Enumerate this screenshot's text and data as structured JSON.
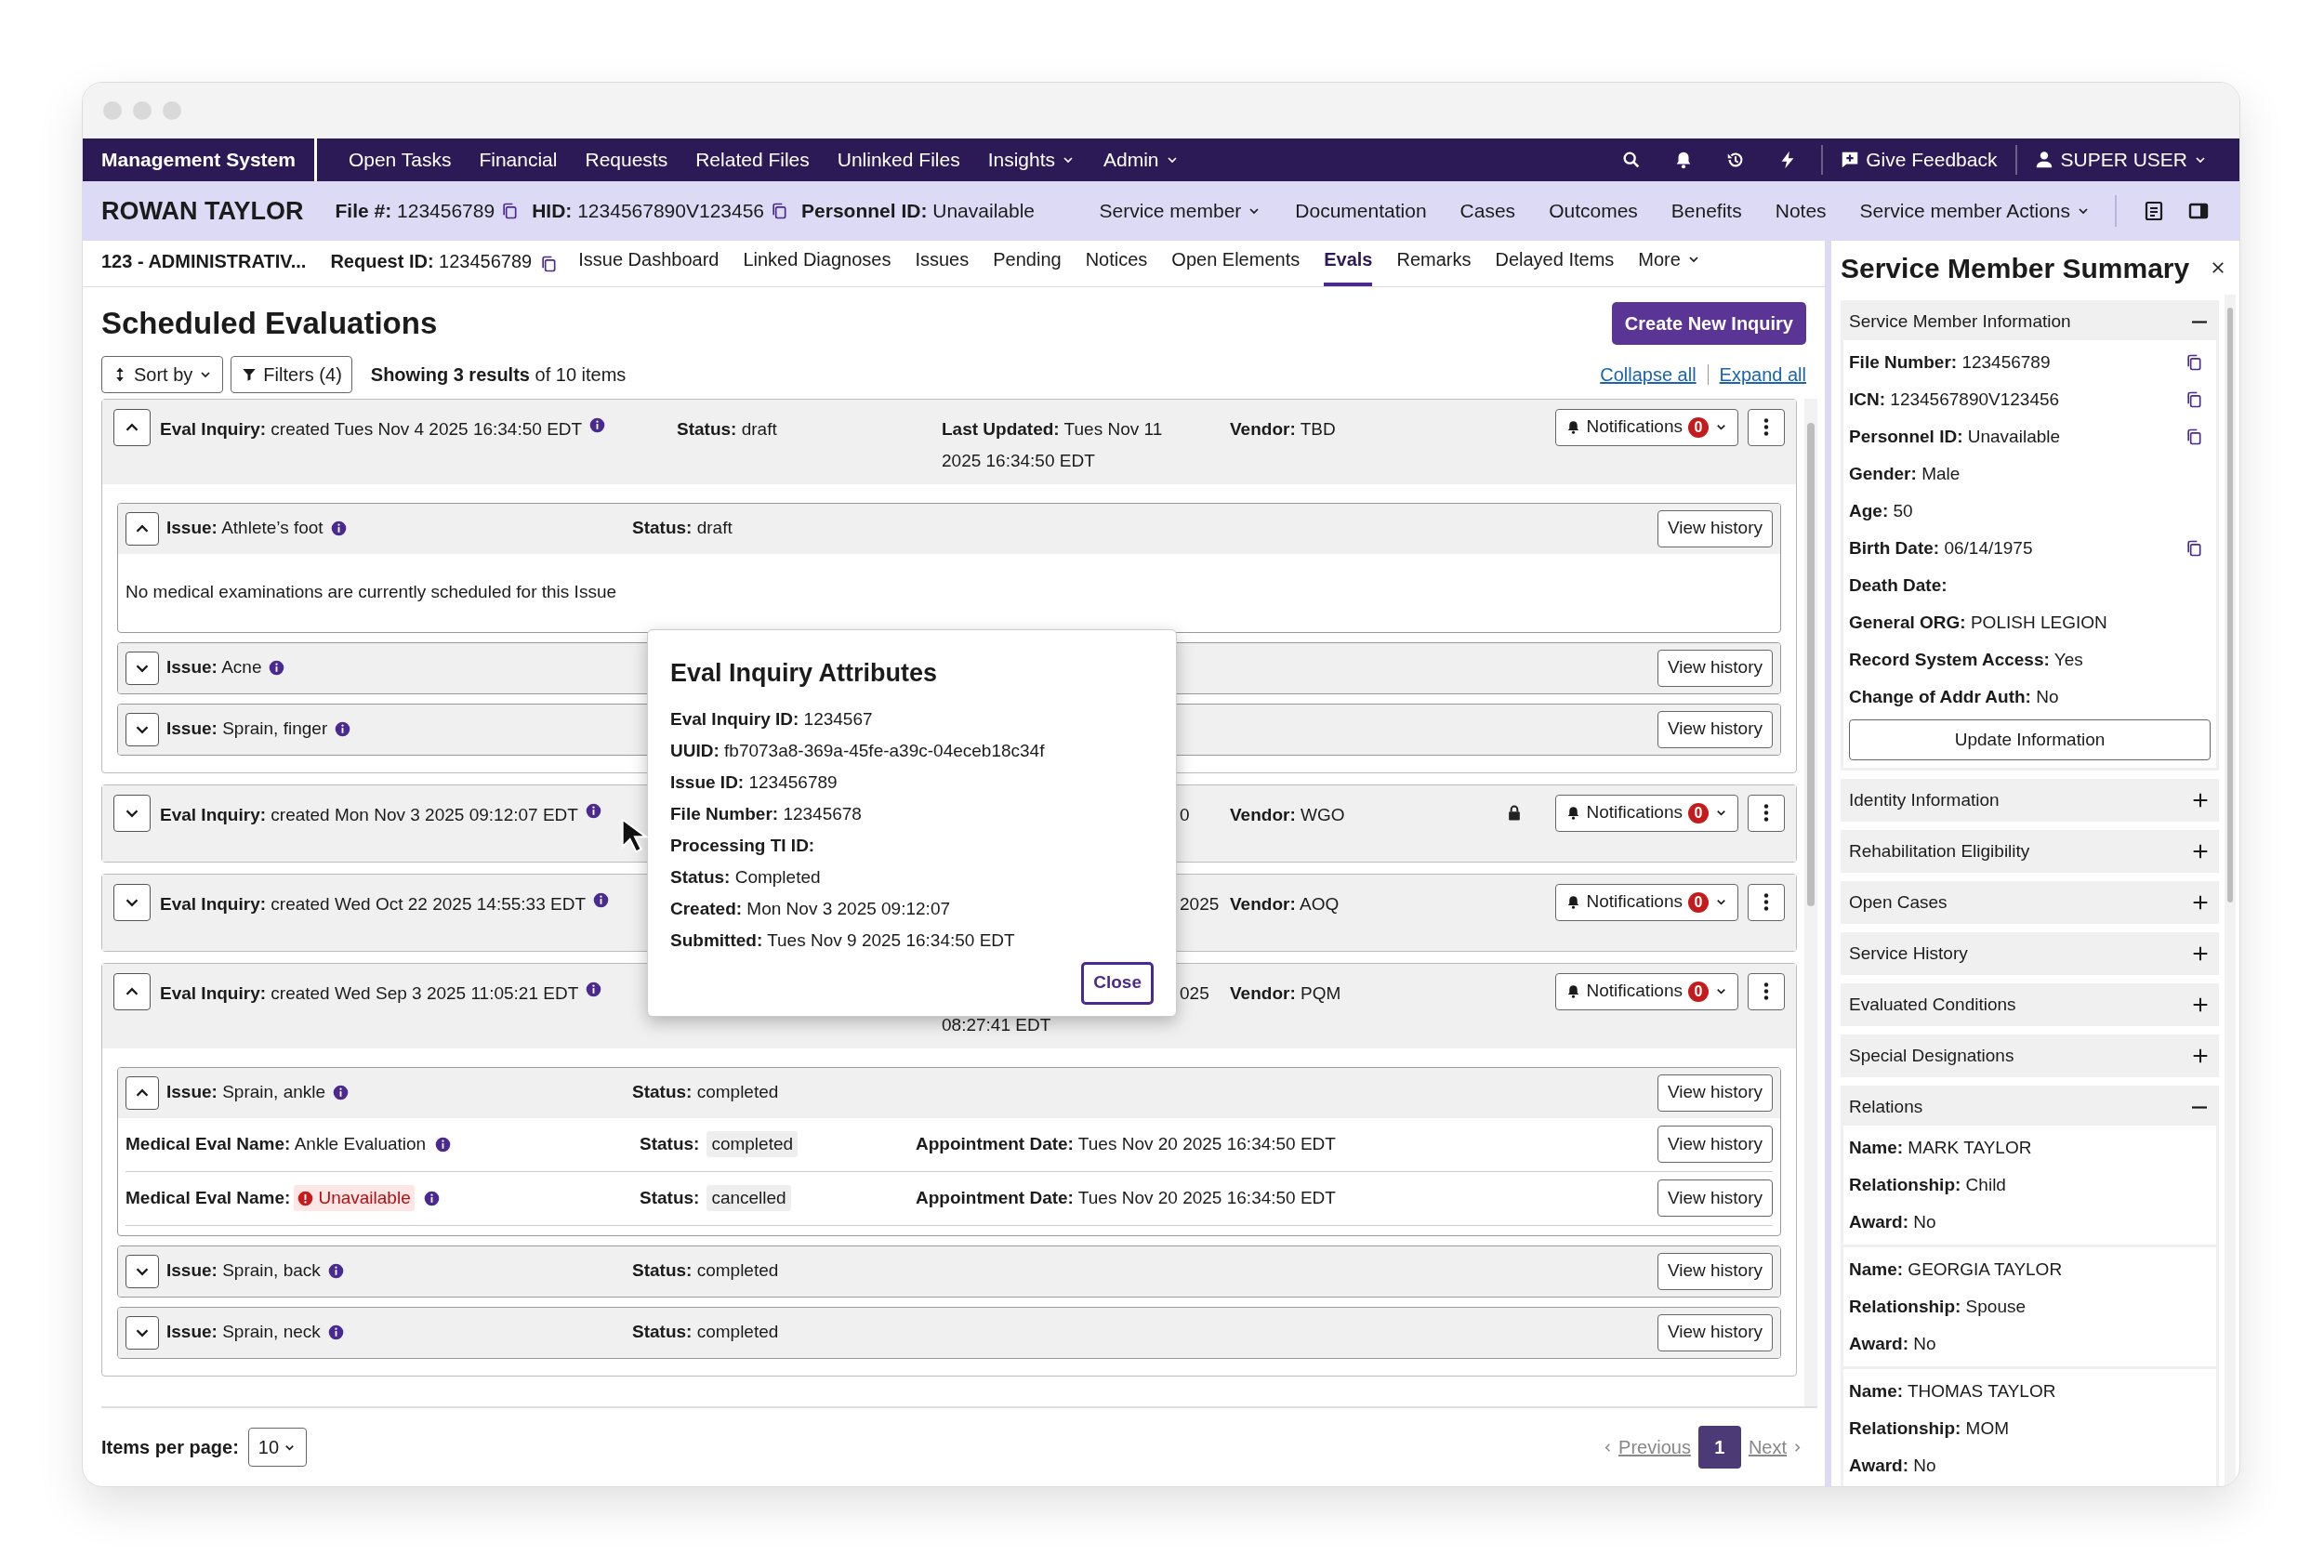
{
  "app_name": "Management System",
  "nav_items": [
    {
      "label": "Open Tasks",
      "dropdown": false
    },
    {
      "label": "Financial",
      "dropdown": false
    },
    {
      "label": "Requests",
      "dropdown": false
    },
    {
      "label": "Related Files",
      "dropdown": false
    },
    {
      "label": "Unlinked Files",
      "dropdown": false
    },
    {
      "label": "Insights",
      "dropdown": true
    },
    {
      "label": "Admin",
      "dropdown": true
    }
  ],
  "feedback": "Give Feedback",
  "user": "SUPER USER",
  "member": {
    "name": "ROWAN TAYLOR",
    "fields": [
      {
        "label": "File #:",
        "value": "123456789",
        "copy": true
      },
      {
        "label": "HID:",
        "value": "1234567890V123456",
        "copy": true
      },
      {
        "label": "Personnel ID:",
        "value": "Unavailable",
        "copy": false
      }
    ]
  },
  "member_nav": [
    {
      "label": "Service member",
      "dropdown": true
    },
    {
      "label": "Documentation",
      "dropdown": false
    },
    {
      "label": "Cases",
      "dropdown": false
    },
    {
      "label": "Outcomes",
      "dropdown": false
    },
    {
      "label": "Benefits",
      "dropdown": false
    },
    {
      "label": "Notes",
      "dropdown": false
    },
    {
      "label": "Service member Actions",
      "dropdown": true
    }
  ],
  "request": {
    "name": "123 - ADMINISTRATIV...",
    "label": "Request ID:",
    "value": "123456789"
  },
  "tabs": [
    {
      "label": "Issue Dashboard",
      "selected": false,
      "dropdown": false
    },
    {
      "label": "Linked Diagnoses",
      "selected": false,
      "dropdown": false
    },
    {
      "label": "Issues",
      "selected": false,
      "dropdown": false
    },
    {
      "label": "Pending",
      "selected": false,
      "dropdown": false
    },
    {
      "label": "Notices",
      "selected": false,
      "dropdown": false
    },
    {
      "label": "Open Elements",
      "selected": false,
      "dropdown": false
    },
    {
      "label": "Evals",
      "selected": true,
      "dropdown": false
    },
    {
      "label": "Remarks",
      "selected": false,
      "dropdown": false
    },
    {
      "label": "Delayed Items",
      "selected": false,
      "dropdown": false
    },
    {
      "label": "More",
      "selected": false,
      "dropdown": true
    }
  ],
  "page_title": "Scheduled Evaluations",
  "create_button": "Create New Inquiry",
  "sort": "Sort by",
  "filters": "Filters (4)",
  "results": "**Showing 3 results** of 10 items",
  "collapse_all": "Collapse all",
  "expand_all": "Expand all",
  "inquiries": [
    {
      "expanded": true,
      "covered": false,
      "label": "Eval Inquiry:",
      "created": "created Tues Nov 4 2025 16:34:50 EDT",
      "status_label": "Status:",
      "status": "draft",
      "updated_label": "Last Updated:",
      "updated_lines": [
        "Tues Nov 11",
        "2025 16:34:50 EDT"
      ],
      "vendor_label": "Vendor:",
      "vendor": "TBD",
      "locked": false,
      "notifications": "Notifications",
      "count": "0",
      "issues": [
        {
          "expanded": true,
          "label": "Issue:",
          "name": "Athlete’s foot",
          "status_label": "Status:",
          "status": "draft",
          "history": "View history",
          "message": "No medical examinations are currently scheduled for this Issue"
        },
        {
          "expanded": false,
          "label": "Issue:",
          "name": "Acne",
          "history": "View history"
        },
        {
          "expanded": false,
          "label": "Issue:",
          "name": "Sprain, finger",
          "history": "View history"
        }
      ]
    },
    {
      "expanded": false,
      "covered": true,
      "label": "Eval Inquiry:",
      "created": "created Mon Nov 3 2025 09:12:07 EDT",
      "updated_lines": [
        "0"
      ],
      "vendor_label": "Vendor:",
      "vendor": "WGO",
      "locked": true,
      "notifications": "Notifications",
      "count": "0"
    },
    {
      "expanded": false,
      "covered": true,
      "label": "Eval Inquiry:",
      "created": "created Wed Oct 22 2025 14:55:33 EDT",
      "updated_lines": [
        "2025"
      ],
      "vendor_label": "Vendor:",
      "vendor": "AOQ",
      "locked": false,
      "notifications": "Notifications",
      "count": "0"
    },
    {
      "expanded": true,
      "covered": true,
      "label": "Eval Inquiry:",
      "created": "created Wed Sep 3 2025 11:05:21 EDT",
      "updated_lines": [
        "025",
        "08:27:41 EDT"
      ],
      "vendor_label": "Vendor:",
      "vendor": "PQM",
      "locked": false,
      "notifications": "Notifications",
      "count": "0",
      "issues": [
        {
          "expanded": true,
          "label": "Issue:",
          "name": "Sprain, ankle",
          "status_label": "Status:",
          "status": "completed",
          "history": "View history",
          "evals": [
            {
              "label": "Medical Eval Name:",
              "name": "Ankle Evaluation",
              "available": true,
              "status_label": "Status:",
              "status": "completed",
              "date_label": "Appointment Date:",
              "date": "Tues Nov 20 2025 16:34:50 EDT",
              "history": "View history"
            },
            {
              "label": "Medical Eval Name:",
              "name": "Unavailable",
              "available": false,
              "status_label": "Status:",
              "status": "cancelled",
              "date_label": "Appointment Date:",
              "date": "Tues Nov 20 2025 16:34:50 EDT",
              "history": "View history"
            }
          ]
        },
        {
          "expanded": false,
          "label": "Issue:",
          "name": "Sprain, back",
          "status_label": "Status:",
          "status": "completed",
          "history": "View history"
        },
        {
          "expanded": false,
          "label": "Issue:",
          "name": "Sprain, neck",
          "status_label": "Status:",
          "status": "completed",
          "history": "View history"
        }
      ]
    }
  ],
  "popup": {
    "title": "Eval Inquiry Attributes",
    "rows": [
      {
        "label": "Eval Inquiry ID:",
        "value": "1234567"
      },
      {
        "label": "UUID:",
        "value": "fb7073a8-369a-45fe-a39c-04eceb18c34f"
      },
      {
        "label": "Issue ID:",
        "value": "123456789"
      },
      {
        "label": "File Number:",
        "value": "12345678"
      },
      {
        "label": "Processing TI ID:"
      },
      {
        "label": "Status:",
        "value": "Completed"
      },
      {
        "label": "Created:",
        "value": "Mon Nov 3 2025 09:12:07"
      },
      {
        "label": "Submitted:",
        "value": "Tues Nov 9 2025 16:34:50 EDT"
      }
    ],
    "close": "Close"
  },
  "footer": {
    "label": "Items per page:",
    "per_page": "10",
    "previous": "Previous",
    "page": "1",
    "next": "Next"
  },
  "summary": {
    "title": "Service Member Summary",
    "sections": [
      {
        "title": "Service Member Information",
        "expanded": true,
        "groups": [
          [
            {
              "label": "File Number:",
              "value": "123456789",
              "copy": true
            },
            {
              "label": "ICN:",
              "value": "1234567890V123456",
              "copy": true
            },
            {
              "label": "Personnel ID:",
              "value": "Unavailable",
              "copy": true
            },
            {
              "label": "Gender:",
              "value": "Male",
              "copy": false
            },
            {
              "label": "Age:",
              "value": "50",
              "copy": false
            },
            {
              "label": "Birth Date:",
              "value": "06/14/1975",
              "copy": true
            },
            {
              "label": "Death Date:",
              "copy": false
            },
            {
              "label": "General ORG:",
              "value": "POLISH LEGION",
              "copy": false
            },
            {
              "label": "Record System Access:",
              "value": "Yes",
              "copy": false
            },
            {
              "label": "Change of Addr Auth:",
              "value": "No",
              "copy": false
            }
          ]
        ],
        "button": "Update Information"
      },
      {
        "title": "Identity Information",
        "expanded": false
      },
      {
        "title": "Rehabilitation Eligibility",
        "expanded": false
      },
      {
        "title": "Open Cases",
        "expanded": false
      },
      {
        "title": "Service History",
        "expanded": false
      },
      {
        "title": "Evaluated Conditions",
        "expanded": false
      },
      {
        "title": "Special Designations",
        "expanded": false
      },
      {
        "title": "Relations",
        "expanded": true,
        "groups": [
          [
            {
              "label": "Name:",
              "value": "MARK TAYLOR",
              "copy": false
            },
            {
              "label": "Relationship:",
              "value": "Child",
              "copy": false
            },
            {
              "label": "Award:",
              "value": "No",
              "copy": false
            }
          ],
          [
            {
              "label": "Name:",
              "value": "GEORGIA TAYLOR",
              "copy": false
            },
            {
              "label": "Relationship:",
              "value": "Spouse",
              "copy": false
            },
            {
              "label": "Award:",
              "value": "No",
              "copy": false
            }
          ],
          [
            {
              "label": "Name:",
              "value": "THOMAS TAYLOR",
              "copy": false
            },
            {
              "label": "Relationship:",
              "value": "MOM",
              "copy": false
            },
            {
              "label": "Award:",
              "value": "No",
              "copy": false
            }
          ]
        ]
      }
    ]
  }
}
